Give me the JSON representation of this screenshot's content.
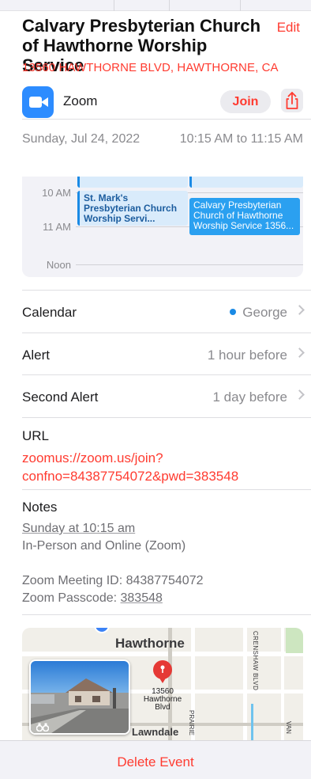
{
  "event": {
    "title": "Calvary Presbyterian Church of Hawthorne Worship Service",
    "edit_label": "Edit",
    "address": "13560 HAWTHORNE BLVD, HAWTHORNE, CA",
    "date": "Sunday, Jul 24, 2022",
    "time_range": "10:15 AM to 11:15 AM"
  },
  "zoom": {
    "label": "Zoom",
    "join_label": "Join",
    "share_icon": "share-icon",
    "logo_icon": "zoom-camera-icon",
    "brand_color": "#2d8cff"
  },
  "calendar_preview": {
    "hours": [
      "10 AM",
      "11 AM",
      "Noon"
    ],
    "events": [
      {
        "title": "St. Mark's Presbyterian Church Worship Servi...",
        "style": "light"
      },
      {
        "title": "Calvary Presbyterian Church of Hawthorne Worship Service 1356...",
        "style": "selected"
      }
    ]
  },
  "details": {
    "calendar_label": "Calendar",
    "calendar_value": "George",
    "calendar_color": "#1a8ae5",
    "alert_label": "Alert",
    "alert_value": "1 hour before",
    "second_alert_label": "Second Alert",
    "second_alert_value": "1 day before"
  },
  "url": {
    "label": "URL",
    "line1": "zoomus://zoom.us/join?",
    "line2": "confno=84387754072&pwd=383548"
  },
  "notes": {
    "label": "Notes",
    "line1": "Sunday at 10:15 am",
    "line2": "In-Person and Online (Zoom)",
    "line3": "Zoom Meeting ID: 84387754072",
    "line4_prefix": "Zoom Passcode: ",
    "line4_code": "383548"
  },
  "map": {
    "city_label": "Hawthorne",
    "pin_label_1": "13560",
    "pin_label_2": "Hawthorne",
    "pin_label_3": "Blvd",
    "area_label": "Lawndale",
    "street_1": "CRENSHAW BLVD",
    "street_2": "PRAIRIE",
    "street_3": "VAN",
    "lookaround_icon": "binoculars-icon",
    "pin_color": "#e53935"
  },
  "actions": {
    "delete_label": "Delete Event"
  }
}
